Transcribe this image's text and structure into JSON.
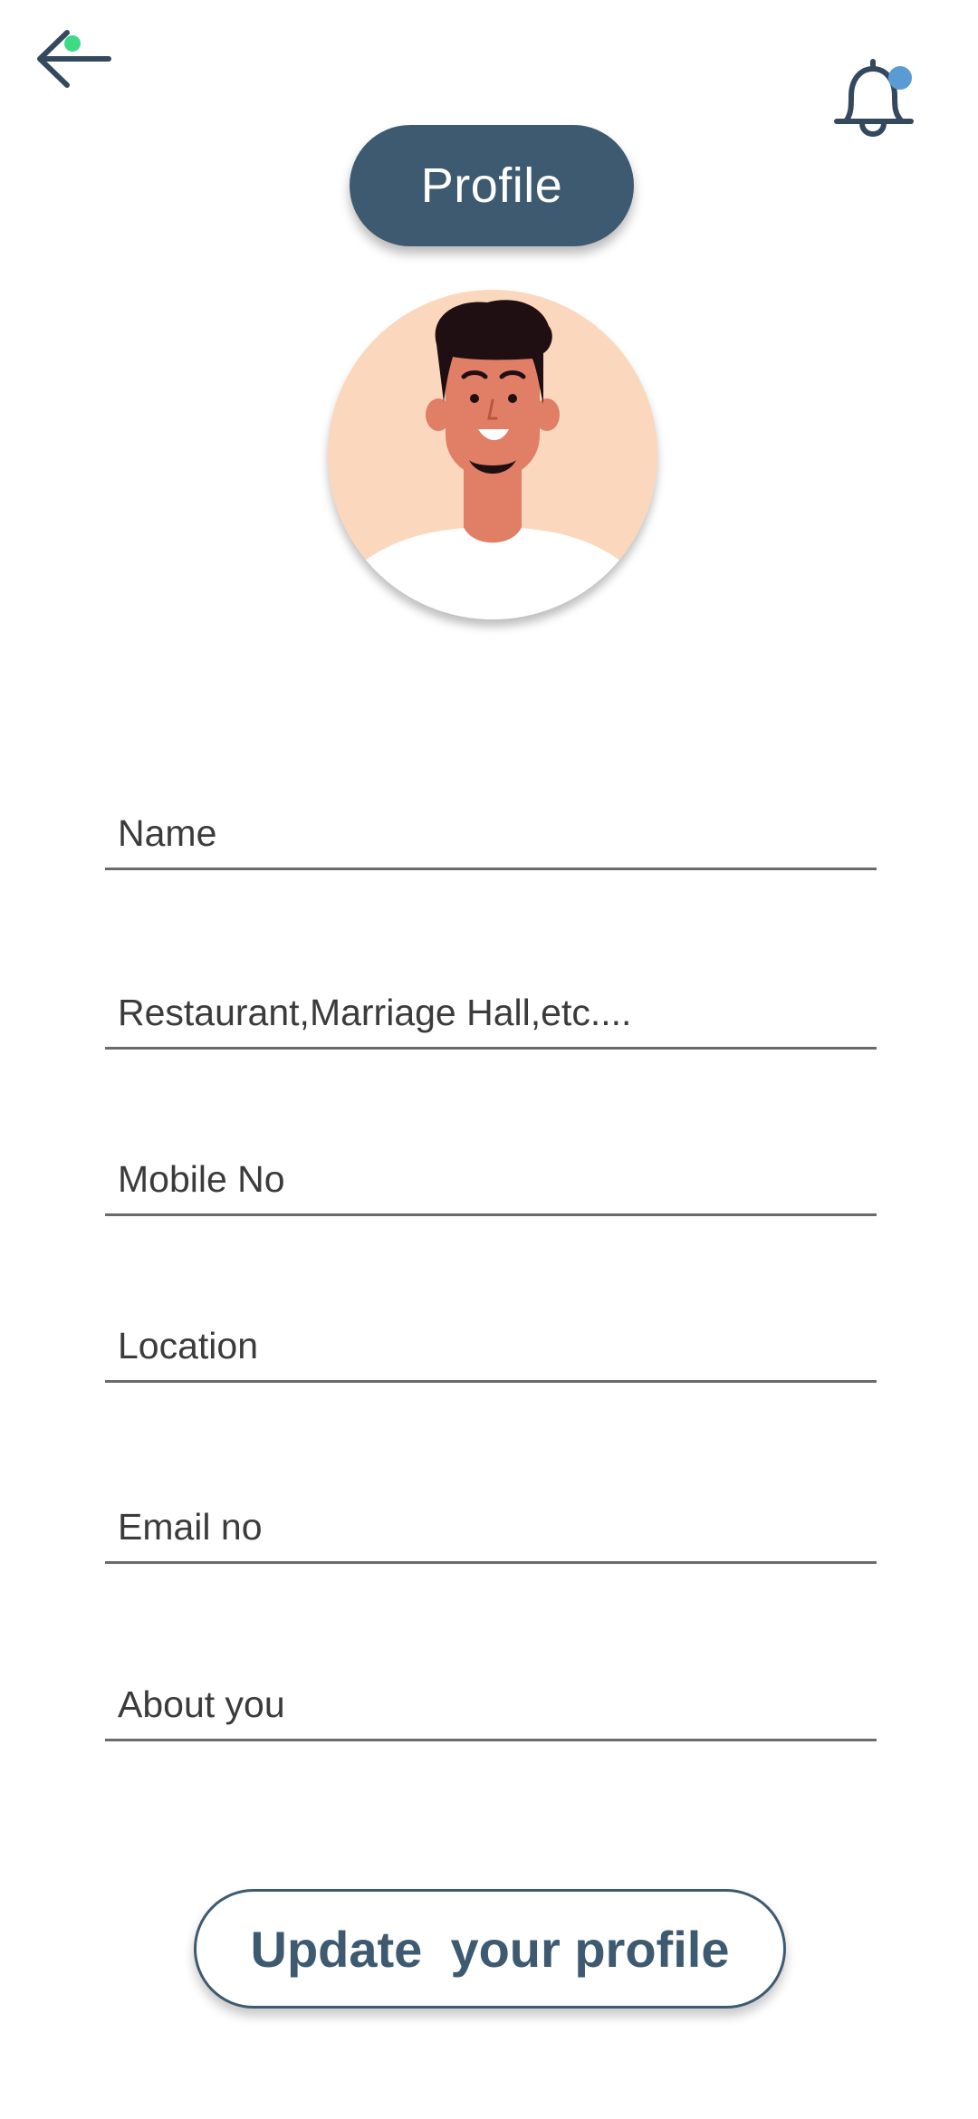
{
  "header": {
    "back_icon": "arrow-left-icon",
    "notification_icon": "bell-icon",
    "back_status_dot_color": "#3ddc84",
    "notification_dot_color": "#5b9bd5"
  },
  "title": {
    "label": "Profile",
    "background_color": "#3d5a70"
  },
  "avatar": {
    "icon": "user-avatar-illustration"
  },
  "form": {
    "fields": [
      {
        "label": "Name"
      },
      {
        "label": "Restaurant,Marriage Hall,etc...."
      },
      {
        "label": "Mobile No"
      },
      {
        "label": "Location"
      },
      {
        "label": "Email no"
      },
      {
        "label": "About you"
      }
    ]
  },
  "actions": {
    "update_label": "Update  your profile",
    "accent_color": "#3d5a70"
  }
}
